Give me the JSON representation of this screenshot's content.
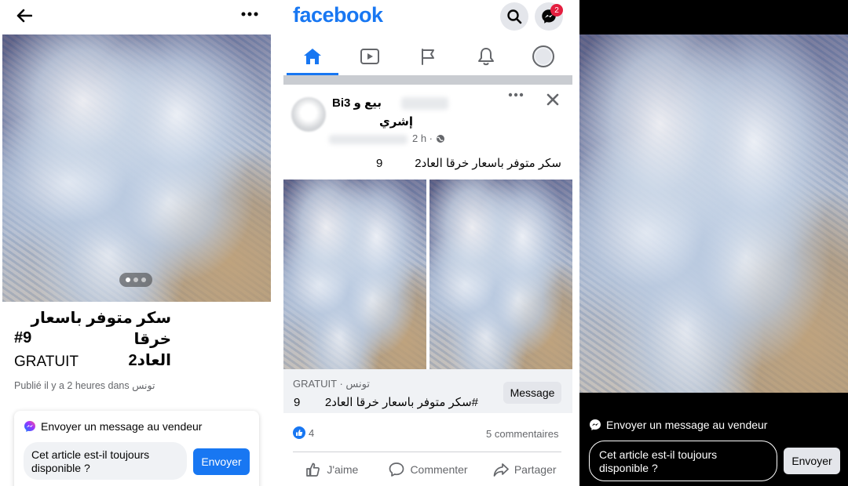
{
  "panel1": {
    "back_icon": "arrow-left-icon",
    "more_icon": "more-horizontal-icon",
    "photo_indicator": {
      "count": 3,
      "current": 1
    },
    "title_line1": "سكر متوفر باسعار خرقا",
    "title_line2": "العاد2",
    "title_hash": "#9",
    "price": "GRATUIT",
    "published": "Publié il y a 2 heures dans تونس",
    "message": {
      "title": "Envoyer un message au vendeur",
      "input_value": "Cet article est-il toujours disponible ?",
      "send_label": "Envoyer"
    }
  },
  "panel2": {
    "logo": "facebook",
    "messenger_badge": "2",
    "nav_icons": [
      "home-icon",
      "watch-icon",
      "pages-flag-icon",
      "notifications-bell-icon",
      "profile-icon"
    ],
    "post": {
      "author_line1": "بيع و Bi3",
      "author_line2": "إشري",
      "time": "2 h ·",
      "text": "سكر متوفر باسعار خرقا العاد2",
      "text_num": "9"
    },
    "listing": {
      "price_location": "GRATUIT · تونس",
      "title": "#سكر متوفر باسعار خرقا العاد2",
      "title_num": "9",
      "message_label": "Message"
    },
    "reactions_count": "4",
    "comments": "5 commentaires",
    "actions": {
      "like": "J'aime",
      "comment": "Commenter",
      "share": "Partager"
    }
  },
  "panel3": {
    "message": {
      "title": "Envoyer un message au vendeur",
      "input_value": "Cet article est-il toujours disponible ?",
      "send_label": "Envoyer"
    }
  }
}
